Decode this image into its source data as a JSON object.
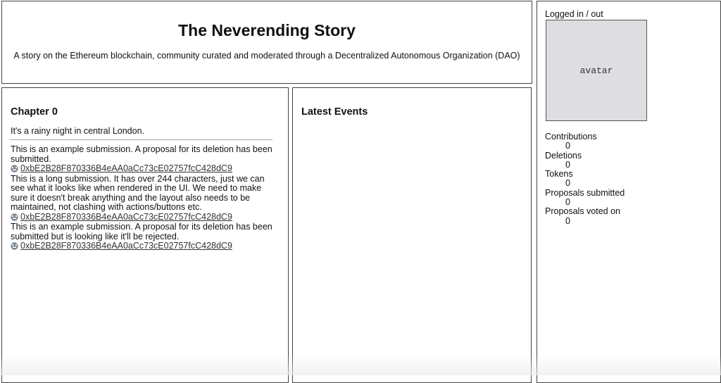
{
  "header": {
    "title": "The Neverending Story",
    "subtitle": "A story on the Ethereum blockchain, community curated and moderated through a Decentralized Autonomous Organization (DAO)"
  },
  "story": {
    "chapter_title": "Chapter 0",
    "intro": "It's a rainy night in central London.",
    "submissions": [
      {
        "text": "This is an example submission. A proposal for its deletion has been submitted.",
        "author": "0xbE2B28F870336B4eAA0aCc73cE02757fcC428dC9",
        "identicon_color": "#7b8794"
      },
      {
        "text": "This is a long submission. It has over 244 characters, just we can see what it looks like when rendered in the UI. We need to make sure it doesn't break anything and the layout also needs to be maintained, not clashing with actions/buttons etc.",
        "author": "0xbE2B28F870336B4eAA0aCc73cE02757fcC428dC9",
        "identicon_color": "#7b8794"
      },
      {
        "text": "This is an example submission. A proposal for its deletion has been submitted but is looking like it'll be rejected.",
        "author": "0xbE2B28F870336B4eAA0aCc73cE02757fcC428dC9",
        "identicon_color": "#7b8794"
      }
    ]
  },
  "events": {
    "title": "Latest Events"
  },
  "profile": {
    "login_status": "Logged in / out",
    "avatar_label": "avatar",
    "stats": [
      {
        "label": "Contributions",
        "value": "0"
      },
      {
        "label": "Deletions",
        "value": "0"
      },
      {
        "label": "Tokens",
        "value": "0"
      },
      {
        "label": "Proposals submitted",
        "value": "0"
      },
      {
        "label": "Proposals voted on",
        "value": "0"
      }
    ]
  }
}
